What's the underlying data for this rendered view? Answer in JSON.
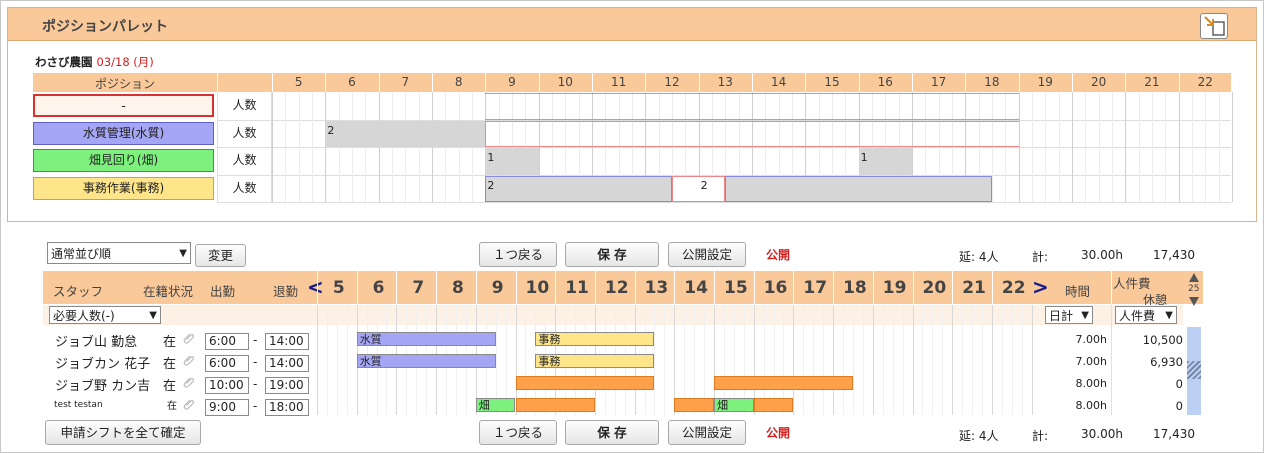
{
  "palette": {
    "title": "ポジションパレット",
    "farm": "わさび農園",
    "date": "03/18 (月)",
    "header_position": "ポジション",
    "hours": [
      "5",
      "6",
      "7",
      "8",
      "9",
      "10",
      "11",
      "12",
      "13",
      "14",
      "15",
      "16",
      "17",
      "18",
      "19",
      "20",
      "21",
      "22"
    ],
    "rows": [
      {
        "name": "-",
        "count_label": "人数",
        "color": "#fff4ec",
        "border": "#d93030"
      },
      {
        "name": "水質管理(水質)",
        "count_label": "人数",
        "color": "#a5a5f5",
        "border": "#6060c0"
      },
      {
        "name": "畑見回り(畑)",
        "count_label": "人数",
        "color": "#7ef07e",
        "border": "#3a9a3a"
      },
      {
        "name": "事務作業(事務)",
        "count_label": "人数",
        "color": "#ffe58a",
        "border": "#c8a830"
      }
    ],
    "counts": [
      {
        "row": 1,
        "hour": 6,
        "value": "2"
      },
      {
        "row": 2,
        "hour": 9,
        "value": "1"
      },
      {
        "row": 2,
        "hour": 16,
        "value": "1"
      },
      {
        "row": 3,
        "hour": 9,
        "value": "2"
      },
      {
        "row": 3,
        "hour": 13,
        "value": "2"
      }
    ]
  },
  "toolbar": {
    "sort_value": "通常並び順",
    "change_label": "変更",
    "back_label": "１つ戻る",
    "save_label": "保 存",
    "publish_settings_label": "公開設定",
    "publish_status": "公開",
    "total_people": "延: 4人",
    "total_label": "計:",
    "total_hours": "30.00h",
    "total_cost": "17,430"
  },
  "schedule": {
    "col_staff": "スタッフ",
    "col_status": "在籍状況",
    "col_in": "出勤",
    "col_out": "退勤",
    "col_time": "時間",
    "col_cost": "人件費",
    "col_break": "休憩",
    "prev": "<",
    "next": ">",
    "scroll_num": "25",
    "hours": [
      "5",
      "6",
      "7",
      "8",
      "9",
      "10",
      "11",
      "12",
      "13",
      "14",
      "15",
      "16",
      "17",
      "18",
      "19",
      "20",
      "21",
      "22"
    ],
    "required_select": "必要人数(-)",
    "daily_select": "日計",
    "cost_select": "人件費",
    "staff": [
      {
        "name": "ジョブ山 勤怠",
        "status": "在",
        "start": "6:00",
        "end": "14:00",
        "hours": "7.00h",
        "cost": "10,500",
        "small": false
      },
      {
        "name": "ジョブカン 花子",
        "status": "在",
        "start": "6:00",
        "end": "14:00",
        "hours": "7.00h",
        "cost": "6,930",
        "small": false
      },
      {
        "name": "ジョブ野 カン吉",
        "status": "在",
        "start": "10:00",
        "end": "19:00",
        "hours": "8.00h",
        "cost": "0",
        "small": false
      },
      {
        "name": "test testan",
        "status": "在",
        "start": "9:00",
        "end": "18:00",
        "hours": "8.00h",
        "cost": "0",
        "small": true
      }
    ],
    "bars": [
      {
        "row": 0,
        "start": 6,
        "end": 9.5,
        "label": "水質",
        "color": "#a5a5f5"
      },
      {
        "row": 0,
        "start": 10.5,
        "end": 13.5,
        "label": "事務",
        "color": "#ffe58a"
      },
      {
        "row": 1,
        "start": 6,
        "end": 9.5,
        "label": "水質",
        "color": "#a5a5f5"
      },
      {
        "row": 1,
        "start": 10.5,
        "end": 13.5,
        "label": "事務",
        "color": "#ffe58a"
      },
      {
        "row": 2,
        "start": 10,
        "end": 13.5,
        "label": "",
        "color": "#ffa04a"
      },
      {
        "row": 2,
        "start": 15,
        "end": 18.5,
        "label": "",
        "color": "#ffa04a"
      },
      {
        "row": 3,
        "start": 9,
        "end": 10,
        "label": "畑",
        "color": "#7ef07e"
      },
      {
        "row": 3,
        "start": 10,
        "end": 12,
        "label": "",
        "color": "#ffa04a"
      },
      {
        "row": 3,
        "start": 14,
        "end": 15,
        "label": "",
        "color": "#ffa04a"
      },
      {
        "row": 3,
        "start": 15,
        "end": 16,
        "label": "畑",
        "color": "#7ef07e"
      },
      {
        "row": 3,
        "start": 16,
        "end": 17,
        "label": "",
        "color": "#ffa04a"
      }
    ],
    "confirm_all_label": "申請シフトを全て確定"
  }
}
